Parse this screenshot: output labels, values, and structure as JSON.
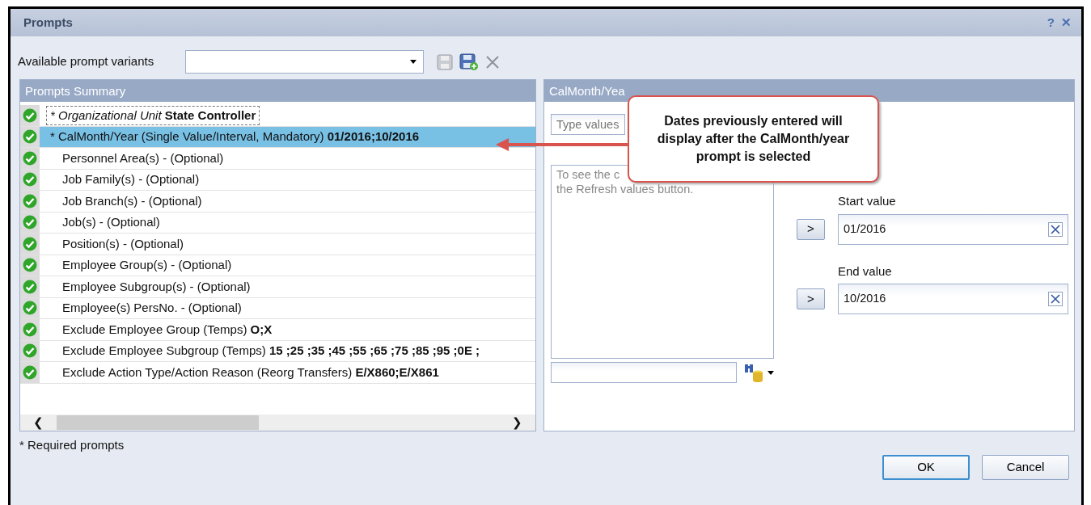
{
  "window": {
    "title": "Prompts",
    "help": "?",
    "close": "✕"
  },
  "variants": {
    "label": "Available prompt variants"
  },
  "summary": {
    "title": "Prompts Summary",
    "rows": [
      {
        "kind": "required",
        "label": "* Organizational Unit",
        "value": "State Controller",
        "italic": true,
        "focused": true,
        "selected": false
      },
      {
        "kind": "required",
        "label": "* CalMonth/Year (Single Value/Interval, Mandatory)",
        "value": "01/2016;10/2016",
        "italic": false,
        "focused": false,
        "selected": true
      },
      {
        "kind": "optional",
        "label": "Personnel Area(s) - (Optional)",
        "italic": false,
        "focused": false,
        "selected": false
      },
      {
        "kind": "optional",
        "label": "Job Family(s) - (Optional)",
        "italic": false,
        "focused": false,
        "selected": false
      },
      {
        "kind": "optional",
        "label": "Job Branch(s) - (Optional)",
        "italic": false,
        "focused": false,
        "selected": false
      },
      {
        "kind": "optional",
        "label": "Job(s) - (Optional)",
        "italic": false,
        "focused": false,
        "selected": false
      },
      {
        "kind": "optional",
        "label": "Position(s) - (Optional)",
        "italic": false,
        "focused": false,
        "selected": false
      },
      {
        "kind": "optional",
        "label": "Employee Group(s) - (Optional)",
        "italic": false,
        "focused": false,
        "selected": false
      },
      {
        "kind": "optional",
        "label": "Employee Subgroup(s) - (Optional)",
        "italic": false,
        "focused": false,
        "selected": false
      },
      {
        "kind": "optional",
        "label": "Employee(s) PersNo. - (Optional)",
        "italic": false,
        "focused": false,
        "selected": false
      },
      {
        "kind": "optional",
        "label": "Exclude Employee Group (Temps)",
        "value": "O;X",
        "italic": false,
        "focused": false,
        "selected": false
      },
      {
        "kind": "optional",
        "label": "Exclude Employee Subgroup (Temps)",
        "value": "15 ;25 ;35 ;45 ;55 ;65 ;75 ;85 ;95 ;0E ;",
        "italic": false,
        "focused": false,
        "selected": false
      },
      {
        "kind": "optional",
        "label": "Exclude Action Type/Action Reason (Reorg Transfers)",
        "value": "E/X860;E/X861",
        "italic": false,
        "focused": false,
        "selected": false
      }
    ],
    "scroll_left": "❮",
    "scroll_right": "❯"
  },
  "detail": {
    "title": "CalMonth/Yea",
    "search_placeholder": "Type values",
    "hint_lines": [
      "To see the c",
      "the Refresh values button."
    ],
    "start_label": "Start value",
    "start_value": "01/2016",
    "end_label": "End value",
    "end_value": "10/2016",
    "add": ">"
  },
  "callout": {
    "text": "Dates previously entered will display after the CalMonth/year prompt is selected"
  },
  "footer": {
    "note": "* Required prompts",
    "buttons": [
      {
        "label": "OK",
        "focused": true
      },
      {
        "label": "Cancel",
        "focused": false
      }
    ]
  }
}
